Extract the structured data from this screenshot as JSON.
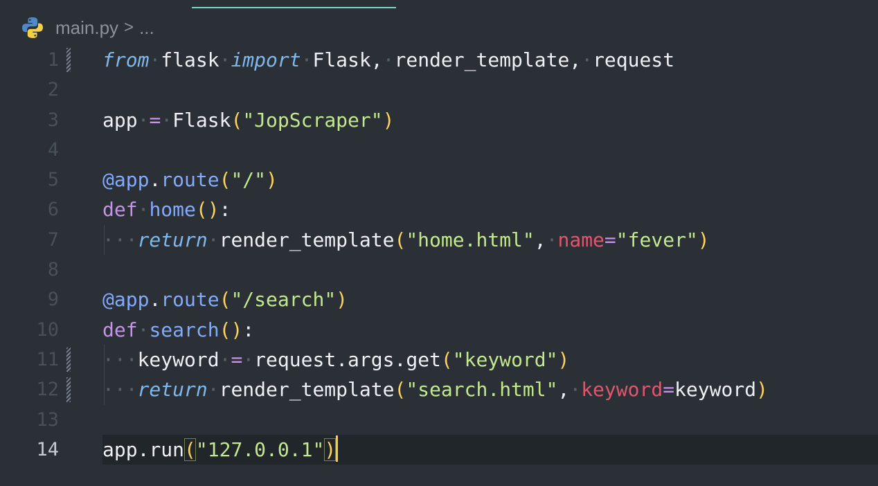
{
  "breadcrumb": {
    "file": "main.py",
    "separator": ">",
    "more": "..."
  },
  "icons": {
    "file_icon": "python-logo-icon"
  },
  "colors": {
    "background": "#2b3036",
    "tab_indicator": "#7fd4c7",
    "keyword": "#7fb8ee",
    "def": "#c594e8",
    "function": "#82aaff",
    "string": "#c3e88d",
    "bracket": "#ffd35a",
    "kwarg": "#e2566d",
    "caret": "#ffcc33"
  },
  "editor": {
    "current_line": 14,
    "lines": [
      {
        "n": "1",
        "tokens": [
          [
            "kw-it",
            "from"
          ],
          [
            "ws",
            "·"
          ],
          [
            "plain",
            "flask"
          ],
          [
            "ws",
            "·"
          ],
          [
            "kw-it",
            "import"
          ],
          [
            "ws",
            "·"
          ],
          [
            "plain",
            "Flask,"
          ],
          [
            "ws",
            "·"
          ],
          [
            "plain",
            "render_template,"
          ],
          [
            "ws",
            "·"
          ],
          [
            "plain",
            "request"
          ]
        ]
      },
      {
        "n": "2",
        "tokens": []
      },
      {
        "n": "3",
        "tokens": [
          [
            "plain",
            "app"
          ],
          [
            "ws",
            "·"
          ],
          [
            "op",
            "="
          ],
          [
            "ws",
            "·"
          ],
          [
            "plain",
            "Flask"
          ],
          [
            "par",
            "("
          ],
          [
            "str",
            "\"JopScraper\""
          ],
          [
            "par",
            ")"
          ]
        ]
      },
      {
        "n": "4",
        "tokens": []
      },
      {
        "n": "5",
        "tokens": [
          [
            "dec",
            "@app"
          ],
          [
            "plain",
            "."
          ],
          [
            "fn",
            "route"
          ],
          [
            "par",
            "("
          ],
          [
            "str",
            "\"/\""
          ],
          [
            "par",
            ")"
          ]
        ]
      },
      {
        "n": "6",
        "tokens": [
          [
            "kw-def",
            "def"
          ],
          [
            "ws",
            "·"
          ],
          [
            "fn",
            "home"
          ],
          [
            "par",
            "()"
          ],
          [
            "plain",
            ":"
          ]
        ]
      },
      {
        "n": "7",
        "tokens": [
          [
            "ws",
            "···"
          ],
          [
            "kw-it",
            "return"
          ],
          [
            "ws",
            "·"
          ],
          [
            "plain",
            "render_template"
          ],
          [
            "par",
            "("
          ],
          [
            "str",
            "\"home.html\""
          ],
          [
            "plain",
            ","
          ],
          [
            "ws",
            "·"
          ],
          [
            "kwarg",
            "name"
          ],
          [
            "op",
            "="
          ],
          [
            "str",
            "\"fever\""
          ],
          [
            "par",
            ")"
          ]
        ]
      },
      {
        "n": "8",
        "tokens": []
      },
      {
        "n": "9",
        "tokens": [
          [
            "dec",
            "@app"
          ],
          [
            "plain",
            "."
          ],
          [
            "fn",
            "route"
          ],
          [
            "par",
            "("
          ],
          [
            "str",
            "\"/search\""
          ],
          [
            "par",
            ")"
          ]
        ]
      },
      {
        "n": "10",
        "tokens": [
          [
            "kw-def",
            "def"
          ],
          [
            "ws",
            "·"
          ],
          [
            "fn",
            "search"
          ],
          [
            "par",
            "()"
          ],
          [
            "plain",
            ":"
          ]
        ]
      },
      {
        "n": "11",
        "tokens": [
          [
            "ws",
            "···"
          ],
          [
            "plain",
            "keyword"
          ],
          [
            "ws",
            "·"
          ],
          [
            "op",
            "="
          ],
          [
            "ws",
            "·"
          ],
          [
            "plain",
            "request"
          ],
          [
            "plain",
            "."
          ],
          [
            "plain",
            "args"
          ],
          [
            "plain",
            "."
          ],
          [
            "plain",
            "get"
          ],
          [
            "par",
            "("
          ],
          [
            "str",
            "\"keyword\""
          ],
          [
            "par",
            ")"
          ]
        ]
      },
      {
        "n": "12",
        "tokens": [
          [
            "ws",
            "···"
          ],
          [
            "kw-it",
            "return"
          ],
          [
            "ws",
            "·"
          ],
          [
            "plain",
            "render_template"
          ],
          [
            "par",
            "("
          ],
          [
            "str",
            "\"search.html\""
          ],
          [
            "plain",
            ","
          ],
          [
            "ws",
            "·"
          ],
          [
            "kwarg",
            "keyword"
          ],
          [
            "op",
            "="
          ],
          [
            "plain",
            "keyword"
          ],
          [
            "par",
            ")"
          ]
        ]
      },
      {
        "n": "13",
        "tokens": []
      },
      {
        "n": "14",
        "tokens": [
          [
            "plain",
            "app"
          ],
          [
            "plain",
            "."
          ],
          [
            "plain",
            "run"
          ],
          [
            "par cursor-par",
            "("
          ],
          [
            "str",
            "\"127.0.0.1\""
          ],
          [
            "par cursor-par",
            ")"
          ]
        ]
      }
    ]
  }
}
